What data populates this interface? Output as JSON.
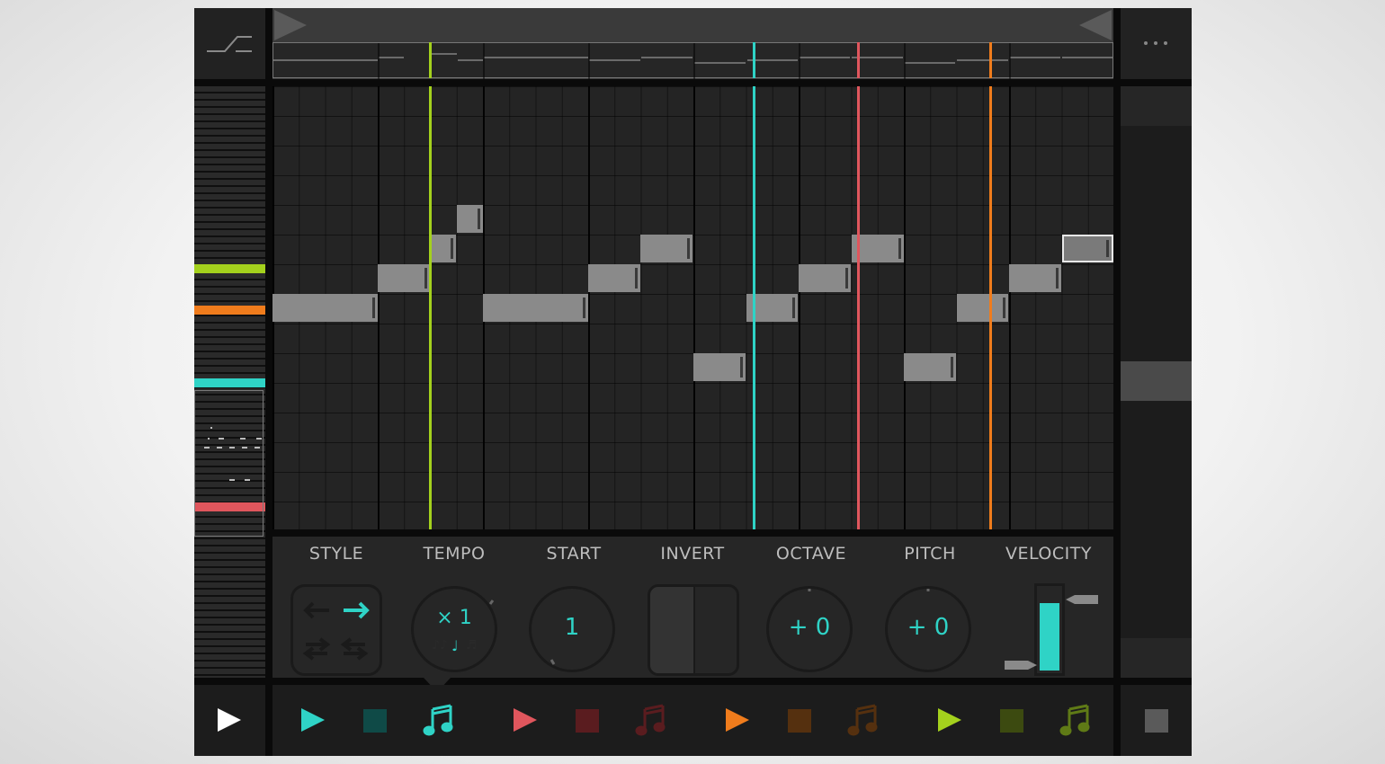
{
  "controls": {
    "style": {
      "label": "STYLE"
    },
    "tempo": {
      "label": "TEMPO",
      "value": "× 1"
    },
    "start": {
      "label": "START",
      "value": "1"
    },
    "invert": {
      "label": "INVERT"
    },
    "octave": {
      "label": "OCTAVE",
      "value": "+ 0"
    },
    "pitch": {
      "label": "PITCH",
      "value": "+ 0"
    },
    "velocity": {
      "label": "VELOCITY",
      "level": 0.8
    }
  },
  "colors": {
    "teal": "#2fd3c6",
    "red": "#e0565d",
    "orange": "#f07c1c",
    "lime": "#a4d11d",
    "grid_bg": "#242424",
    "note": "#8a8a8a"
  },
  "icons": {
    "top_left": "quantize-step-icon",
    "top_right": "more-dots-icon",
    "master_play": "play-icon",
    "master_stop": "stop-icon"
  },
  "playheads": [
    "lime",
    "teal",
    "red",
    "orange"
  ],
  "tracks": [
    {
      "color": "teal",
      "play": "play-icon",
      "stop": "stop-icon",
      "note": "music-note-icon",
      "active": true
    },
    {
      "color": "red",
      "play": "play-icon",
      "stop": "stop-icon",
      "note": "music-note-icon",
      "active": false
    },
    {
      "color": "orange",
      "play": "play-icon",
      "stop": "stop-icon",
      "note": "music-note-icon",
      "active": false
    },
    {
      "color": "lime",
      "play": "play-icon",
      "stop": "stop-icon",
      "note": "music-note-icon",
      "active": false
    }
  ]
}
